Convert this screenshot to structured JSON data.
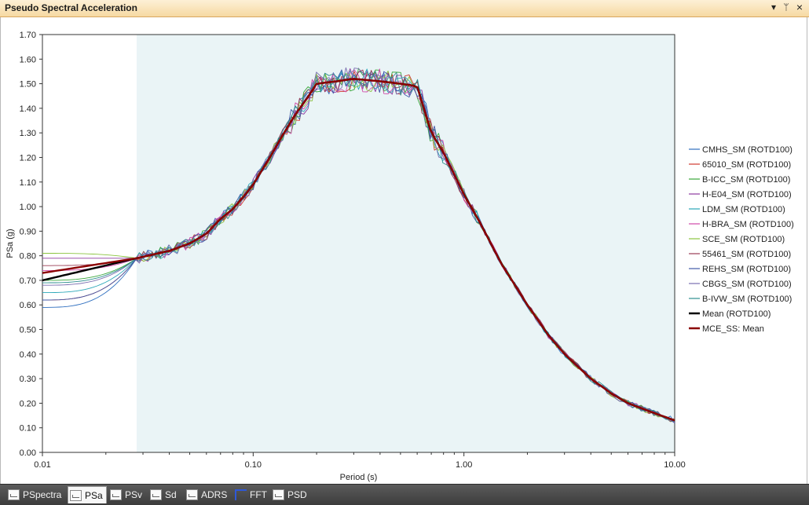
{
  "window": {
    "title": "Pseudo Spectral Acceleration",
    "controls": {
      "dropdown": "▾",
      "pin": "ᛘ",
      "close": "×"
    }
  },
  "tabs": [
    {
      "label": "PSpectra",
      "icon": "spectra-icon",
      "active": false
    },
    {
      "label": "PSa",
      "icon": "psa-icon",
      "active": true
    },
    {
      "label": "PSv",
      "icon": "psv-icon",
      "active": false
    },
    {
      "label": "Sd",
      "icon": "sd-icon",
      "active": false
    },
    {
      "label": "ADRS",
      "icon": "adrs-icon",
      "active": false
    },
    {
      "label": "FFT",
      "icon": "fft-icon",
      "active": false
    },
    {
      "label": "PSD",
      "icon": "psd-icon",
      "active": false
    }
  ],
  "chart_data": {
    "type": "line",
    "title": "Pseudo Spectral Acceleration",
    "xlabel": "Period (s)",
    "ylabel": "PSa (g)",
    "xscale": "log",
    "xlim": [
      0.01,
      10.0
    ],
    "ylim": [
      0.0,
      1.7
    ],
    "xticks": [
      "0.01",
      "0.10",
      "1.00",
      "10.00"
    ],
    "yticks": [
      "0.00",
      "0.10",
      "0.20",
      "0.30",
      "0.40",
      "0.50",
      "0.60",
      "0.70",
      "0.80",
      "0.90",
      "1.00",
      "1.10",
      "1.20",
      "1.30",
      "1.40",
      "1.50",
      "1.60",
      "1.70"
    ],
    "grid": false,
    "legend_position": "right",
    "shaded_region": {
      "x": [
        0.028,
        10.0
      ],
      "color": "#eaf4f6"
    },
    "base_curve": {
      "x": [
        0.028,
        0.04,
        0.05,
        0.06,
        0.07,
        0.08,
        0.09,
        0.1,
        0.12,
        0.14,
        0.16,
        0.18,
        0.2,
        0.25,
        0.3,
        0.4,
        0.5,
        0.6,
        0.7,
        0.8,
        1.0,
        1.2,
        1.5,
        2.0,
        2.5,
        3.0,
        4.0,
        5.0,
        6.0,
        8.0,
        10.0
      ],
      "y": [
        0.79,
        0.82,
        0.85,
        0.89,
        0.95,
        0.99,
        1.04,
        1.09,
        1.2,
        1.3,
        1.38,
        1.44,
        1.5,
        1.51,
        1.52,
        1.51,
        1.5,
        1.49,
        1.3,
        1.22,
        1.05,
        0.93,
        0.77,
        0.6,
        0.48,
        0.4,
        0.3,
        0.24,
        0.2,
        0.16,
        0.13
      ]
    },
    "series": [
      {
        "name": "CMHS_SM (ROTD100)",
        "color": "#2f6fbf",
        "start": 0.59,
        "seed": 1
      },
      {
        "name": "65010_SM (ROTD100)",
        "color": "#d0392f",
        "start": 0.62,
        "seed": 2
      },
      {
        "name": "B-ICC_SM (ROTD100)",
        "color": "#38a63a",
        "start": 0.7,
        "seed": 3
      },
      {
        "name": "H-E04_SM (ROTD100)",
        "color": "#8e3aa0",
        "start": 0.79,
        "seed": 4
      },
      {
        "name": "LDM_SM (ROTD100)",
        "color": "#2aa7b8",
        "start": 0.65,
        "seed": 5
      },
      {
        "name": "H-BRA_SM (ROTD100)",
        "color": "#d04aa8",
        "start": 0.74,
        "seed": 6
      },
      {
        "name": "SCE_SM (ROTD100)",
        "color": "#8bc43f",
        "start": 0.81,
        "seed": 7
      },
      {
        "name": "55461_SM (ROTD100)",
        "color": "#9a3d55",
        "start": 0.76,
        "seed": 8
      },
      {
        "name": "REHS_SM (ROTD100)",
        "color": "#4159a8",
        "start": 0.62,
        "seed": 9
      },
      {
        "name": "CBGS_SM (ROTD100)",
        "color": "#7a6fb0",
        "start": 0.68,
        "seed": 10
      },
      {
        "name": "B-IVW_SM (ROTD100)",
        "color": "#2f8f8f",
        "start": 0.69,
        "seed": 11
      },
      {
        "name": "Mean (ROTD100)",
        "color": "#000000",
        "start": 0.7,
        "seed": 0,
        "bold": true
      },
      {
        "name": "MCE_SS: Mean",
        "color": "#8b0000",
        "start": 0.73,
        "seed": 0,
        "bold": true
      }
    ]
  }
}
